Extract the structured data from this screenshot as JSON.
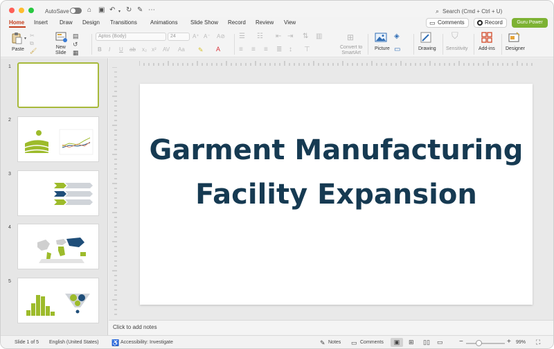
{
  "window": {
    "autosave_label": "AutoSave",
    "search_placeholder": "Search (Cmd + Ctrl + U)"
  },
  "tabs": [
    "Home",
    "Insert",
    "Draw",
    "Design",
    "Transitions",
    "Animations",
    "Slide Show",
    "Record",
    "Review",
    "View"
  ],
  "active_tab": "Home",
  "header_buttons": {
    "comments": "Comments",
    "record": "Record",
    "guru": "Guru Power"
  },
  "colors": {
    "accent": "#c43e1c",
    "guru_green": "#7db233",
    "title_color": "#163a52",
    "thumb_green": "#a7b93a"
  },
  "ribbon": {
    "paste": "Paste",
    "new_slide": "New\nSlide",
    "font_name": "Aptos (Body)",
    "font_size": "24",
    "convert_smartart": "Convert to\nSmartArt",
    "picture": "Picture",
    "drawing": "Drawing",
    "sensitivity": "Sensitivity",
    "addins": "Add-ins",
    "designer": "Designer"
  },
  "slides": [
    {
      "num": "1",
      "kind": "blank"
    },
    {
      "num": "2",
      "kind": "farm-line-chart"
    },
    {
      "num": "3",
      "kind": "arrows"
    },
    {
      "num": "4",
      "kind": "world-map"
    },
    {
      "num": "5",
      "kind": "histogram-funnel"
    }
  ],
  "main_slide": {
    "title": "Garment Manufacturing Facility Expansion"
  },
  "notes": {
    "placeholder": "Click to add notes"
  },
  "status": {
    "slide_of": "Slide 1 of 5",
    "language": "English (United States)",
    "accessibility": "Accessibility: Investigate",
    "notes": "Notes",
    "comments": "Comments",
    "zoom": "99%"
  }
}
